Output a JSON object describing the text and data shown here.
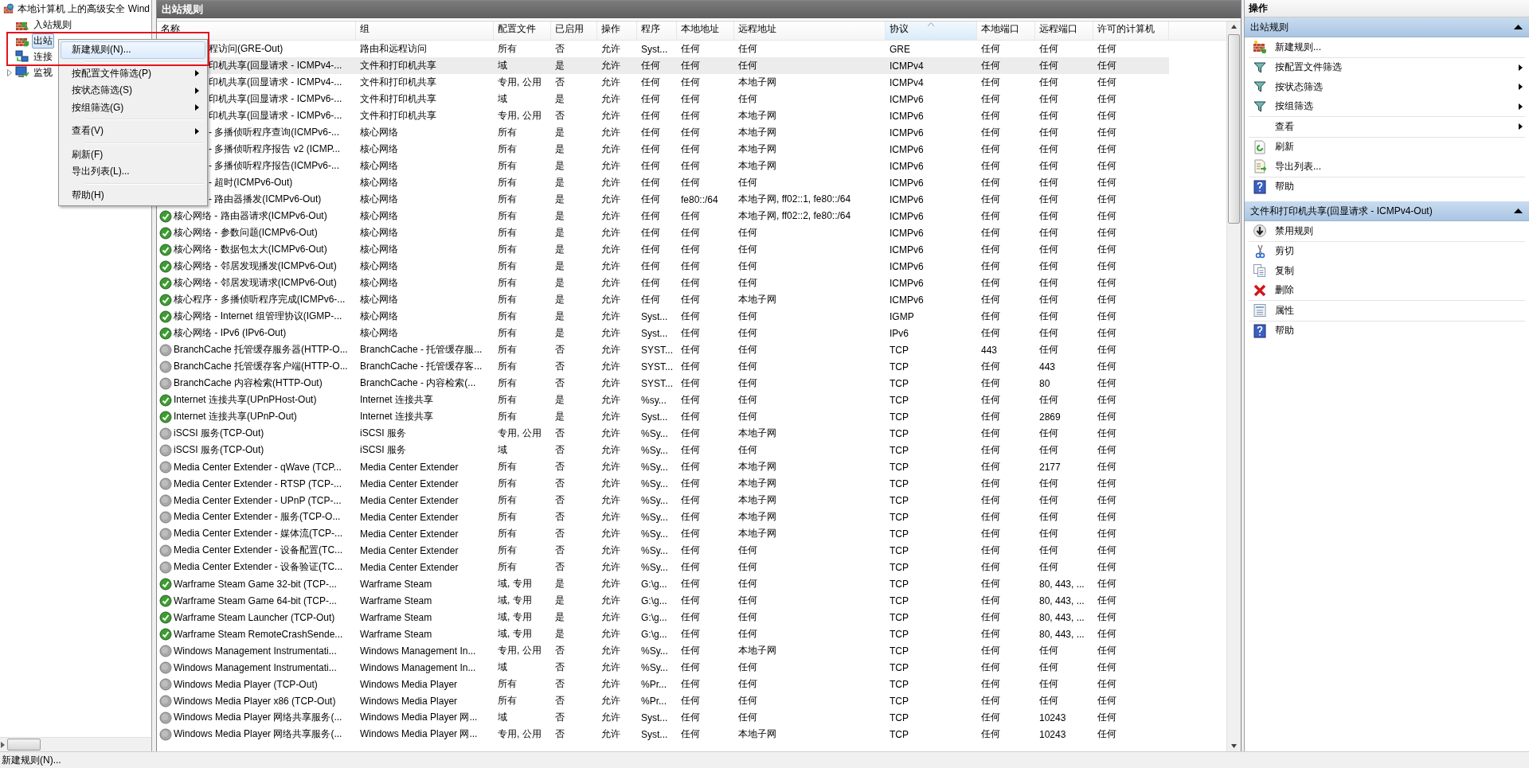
{
  "tree": {
    "label": "本地计算机 上的高级安全 Wind",
    "kind": "root",
    "children": [
      {
        "label": "入站规则",
        "kind": "inbound",
        "selected": false
      },
      {
        "label": "出站",
        "kind": "outbound",
        "selected": true
      },
      {
        "label": "连接",
        "kind": "connection",
        "selected": false
      },
      {
        "label": "监视",
        "kind": "monitor",
        "selected": false,
        "expanded": false
      }
    ]
  },
  "context_menu": {
    "groups": [
      {
        "items": [
          {
            "label": "新建规则(N)...",
            "selected": true,
            "submenu": false
          }
        ]
      },
      {
        "items": [
          {
            "label": "按配置文件筛选(P)",
            "selected": false,
            "submenu": true
          },
          {
            "label": "按状态筛选(S)",
            "selected": false,
            "submenu": true
          },
          {
            "label": "按组筛选(G)",
            "selected": false,
            "submenu": true
          }
        ]
      },
      {
        "items": [
          {
            "label": "查看(V)",
            "selected": false,
            "submenu": true
          }
        ]
      },
      {
        "items": [
          {
            "label": "刷新(F)",
            "selected": false,
            "submenu": false
          },
          {
            "label": "导出列表(L)...",
            "selected": false,
            "submenu": false
          }
        ]
      },
      {
        "items": [
          {
            "label": "帮助(H)",
            "selected": false,
            "submenu": false
          }
        ]
      }
    ]
  },
  "center": {
    "title": "出站规则",
    "columns": [
      {
        "label": "名称",
        "sorted": false
      },
      {
        "label": "组",
        "sorted": false
      },
      {
        "label": "配置文件",
        "sorted": false
      },
      {
        "label": "已启用",
        "sorted": false
      },
      {
        "label": "操作",
        "sorted": false
      },
      {
        "label": "程序",
        "sorted": false
      },
      {
        "label": "本地地址",
        "sorted": false
      },
      {
        "label": "远程地址",
        "sorted": false
      },
      {
        "label": "协议",
        "sorted": true
      },
      {
        "label": "本地端口",
        "sorted": false
      },
      {
        "label": "远程端口",
        "sorted": false
      },
      {
        "label": "许可的计算机",
        "sorted": false
      }
    ],
    "rows": [
      {
        "covered": true,
        "selected": false,
        "cells": [
          "程访问(GRE-Out)",
          "路由和远程访问",
          "所有",
          "否",
          "允许",
          "Syst...",
          "任何",
          "任何",
          "GRE",
          "任何",
          "任何",
          "任何"
        ]
      },
      {
        "covered": true,
        "selected": true,
        "cells": [
          "印机共享(回显请求 - ICMPv4-...",
          "文件和打印机共享",
          "域",
          "是",
          "允许",
          "任何",
          "任何",
          "任何",
          "ICMPv4",
          "任何",
          "任何",
          "任何"
        ]
      },
      {
        "covered": true,
        "selected": false,
        "cells": [
          "印机共享(回显请求 - ICMPv4-...",
          "文件和打印机共享",
          "专用, 公用",
          "否",
          "允许",
          "任何",
          "任何",
          "本地子网",
          "ICMPv4",
          "任何",
          "任何",
          "任何"
        ]
      },
      {
        "covered": true,
        "selected": false,
        "cells": [
          "印机共享(回显请求 - ICMPv6-...",
          "文件和打印机共享",
          "域",
          "是",
          "允许",
          "任何",
          "任何",
          "任何",
          "ICMPv6",
          "任何",
          "任何",
          "任何"
        ]
      },
      {
        "covered": true,
        "selected": false,
        "cells": [
          "印机共享(回显请求 - ICMPv6-...",
          "文件和打印机共享",
          "专用, 公用",
          "否",
          "允许",
          "任何",
          "任何",
          "本地子网",
          "ICMPv6",
          "任何",
          "任何",
          "任何"
        ]
      },
      {
        "covered": true,
        "selected": false,
        "cells": [
          "- 多播侦听程序查询(ICMPv6-...",
          "核心网络",
          "所有",
          "是",
          "允许",
          "任何",
          "任何",
          "本地子网",
          "ICMPv6",
          "任何",
          "任何",
          "任何"
        ]
      },
      {
        "covered": true,
        "selected": false,
        "cells": [
          "- 多播侦听程序报告 v2 (ICMP...",
          "核心网络",
          "所有",
          "是",
          "允许",
          "任何",
          "任何",
          "本地子网",
          "ICMPv6",
          "任何",
          "任何",
          "任何"
        ]
      },
      {
        "covered": true,
        "selected": false,
        "cells": [
          "- 多播侦听程序报告(ICMPv6-...",
          "核心网络",
          "所有",
          "是",
          "允许",
          "任何",
          "任何",
          "本地子网",
          "ICMPv6",
          "任何",
          "任何",
          "任何"
        ]
      },
      {
        "covered": true,
        "selected": false,
        "cells": [
          "- 超时(ICMPv6-Out)",
          "核心网络",
          "所有",
          "是",
          "允许",
          "任何",
          "任何",
          "任何",
          "ICMPv6",
          "任何",
          "任何",
          "任何"
        ]
      },
      {
        "covered": true,
        "selected": false,
        "cells": [
          "- 路由器播发(ICMPv6-Out)",
          "核心网络",
          "所有",
          "是",
          "允许",
          "任何",
          "fe80::/64",
          "本地子网, ff02::1, fe80::/64",
          "ICMPv6",
          "任何",
          "任何",
          "任何"
        ]
      },
      {
        "covered": false,
        "enabled": true,
        "selected": false,
        "cells": [
          "核心网络 - 路由器请求(ICMPv6-Out)",
          "核心网络",
          "所有",
          "是",
          "允许",
          "任何",
          "任何",
          "本地子网, ff02::2, fe80::/64",
          "ICMPv6",
          "任何",
          "任何",
          "任何"
        ]
      },
      {
        "covered": false,
        "enabled": true,
        "selected": false,
        "cells": [
          "核心网络 - 参数问题(ICMPv6-Out)",
          "核心网络",
          "所有",
          "是",
          "允许",
          "任何",
          "任何",
          "任何",
          "ICMPv6",
          "任何",
          "任何",
          "任何"
        ]
      },
      {
        "covered": false,
        "enabled": true,
        "selected": false,
        "cells": [
          "核心网络 - 数据包太大(ICMPv6-Out)",
          "核心网络",
          "所有",
          "是",
          "允许",
          "任何",
          "任何",
          "任何",
          "ICMPv6",
          "任何",
          "任何",
          "任何"
        ]
      },
      {
        "covered": false,
        "enabled": true,
        "selected": false,
        "cells": [
          "核心网络 - 邻居发现播发(ICMPv6-Out)",
          "核心网络",
          "所有",
          "是",
          "允许",
          "任何",
          "任何",
          "任何",
          "ICMPv6",
          "任何",
          "任何",
          "任何"
        ]
      },
      {
        "covered": false,
        "enabled": true,
        "selected": false,
        "cells": [
          "核心网络 - 邻居发现请求(ICMPv6-Out)",
          "核心网络",
          "所有",
          "是",
          "允许",
          "任何",
          "任何",
          "任何",
          "ICMPv6",
          "任何",
          "任何",
          "任何"
        ]
      },
      {
        "covered": false,
        "enabled": true,
        "selected": false,
        "cells": [
          "核心程序 - 多播侦听程序完成(ICMPv6-...",
          "核心网络",
          "所有",
          "是",
          "允许",
          "任何",
          "任何",
          "本地子网",
          "ICMPv6",
          "任何",
          "任何",
          "任何"
        ]
      },
      {
        "covered": false,
        "enabled": true,
        "selected": false,
        "cells": [
          "核心网络 - Internet 组管理协议(IGMP-...",
          "核心网络",
          "所有",
          "是",
          "允许",
          "Syst...",
          "任何",
          "任何",
          "IGMP",
          "任何",
          "任何",
          "任何"
        ]
      },
      {
        "covered": false,
        "enabled": true,
        "selected": false,
        "cells": [
          "核心网络 - IPv6 (IPv6-Out)",
          "核心网络",
          "所有",
          "是",
          "允许",
          "Syst...",
          "任何",
          "任何",
          "IPv6",
          "任何",
          "任何",
          "任何"
        ]
      },
      {
        "covered": false,
        "enabled": false,
        "selected": false,
        "cells": [
          "BranchCache 托管缓存服务器(HTTP-O...",
          "BranchCache - 托管缓存服...",
          "所有",
          "否",
          "允许",
          "SYST...",
          "任何",
          "任何",
          "TCP",
          "443",
          "任何",
          "任何"
        ]
      },
      {
        "covered": false,
        "enabled": false,
        "selected": false,
        "cells": [
          "BranchCache 托管缓存客户端(HTTP-O...",
          "BranchCache - 托管缓存客...",
          "所有",
          "否",
          "允许",
          "SYST...",
          "任何",
          "任何",
          "TCP",
          "任何",
          "443",
          "任何"
        ]
      },
      {
        "covered": false,
        "enabled": false,
        "selected": false,
        "cells": [
          "BranchCache 内容检索(HTTP-Out)",
          "BranchCache - 内容检索(...",
          "所有",
          "否",
          "允许",
          "SYST...",
          "任何",
          "任何",
          "TCP",
          "任何",
          "80",
          "任何"
        ]
      },
      {
        "covered": false,
        "enabled": true,
        "selected": false,
        "cells": [
          "Internet 连接共享(UPnPHost-Out)",
          "Internet 连接共享",
          "所有",
          "是",
          "允许",
          "%sy...",
          "任何",
          "任何",
          "TCP",
          "任何",
          "任何",
          "任何"
        ]
      },
      {
        "covered": false,
        "enabled": true,
        "selected": false,
        "cells": [
          "Internet 连接共享(UPnP-Out)",
          "Internet 连接共享",
          "所有",
          "是",
          "允许",
          "Syst...",
          "任何",
          "任何",
          "TCP",
          "任何",
          "2869",
          "任何"
        ]
      },
      {
        "covered": false,
        "enabled": false,
        "selected": false,
        "cells": [
          "iSCSI 服务(TCP-Out)",
          "iSCSI 服务",
          "专用, 公用",
          "否",
          "允许",
          "%Sy...",
          "任何",
          "本地子网",
          "TCP",
          "任何",
          "任何",
          "任何"
        ]
      },
      {
        "covered": false,
        "enabled": false,
        "selected": false,
        "cells": [
          "iSCSI 服务(TCP-Out)",
          "iSCSI 服务",
          "域",
          "否",
          "允许",
          "%Sy...",
          "任何",
          "任何",
          "TCP",
          "任何",
          "任何",
          "任何"
        ]
      },
      {
        "covered": false,
        "enabled": false,
        "selected": false,
        "cells": [
          "Media Center Extender - qWave (TCP...",
          "Media Center Extender",
          "所有",
          "否",
          "允许",
          "%Sy...",
          "任何",
          "本地子网",
          "TCP",
          "任何",
          "2177",
          "任何"
        ]
      },
      {
        "covered": false,
        "enabled": false,
        "selected": false,
        "cells": [
          "Media Center Extender - RTSP (TCP-...",
          "Media Center Extender",
          "所有",
          "否",
          "允许",
          "%Sy...",
          "任何",
          "本地子网",
          "TCP",
          "任何",
          "任何",
          "任何"
        ]
      },
      {
        "covered": false,
        "enabled": false,
        "selected": false,
        "cells": [
          "Media Center Extender - UPnP (TCP-...",
          "Media Center Extender",
          "所有",
          "否",
          "允许",
          "%Sy...",
          "任何",
          "本地子网",
          "TCP",
          "任何",
          "任何",
          "任何"
        ]
      },
      {
        "covered": false,
        "enabled": false,
        "selected": false,
        "cells": [
          "Media Center Extender - 服务(TCP-O...",
          "Media Center Extender",
          "所有",
          "否",
          "允许",
          "%Sy...",
          "任何",
          "本地子网",
          "TCP",
          "任何",
          "任何",
          "任何"
        ]
      },
      {
        "covered": false,
        "enabled": false,
        "selected": false,
        "cells": [
          "Media Center Extender - 媒体流(TCP-...",
          "Media Center Extender",
          "所有",
          "否",
          "允许",
          "%Sy...",
          "任何",
          "本地子网",
          "TCP",
          "任何",
          "任何",
          "任何"
        ]
      },
      {
        "covered": false,
        "enabled": false,
        "selected": false,
        "cells": [
          "Media Center Extender - 设备配置(TC...",
          "Media Center Extender",
          "所有",
          "否",
          "允许",
          "%Sy...",
          "任何",
          "任何",
          "TCP",
          "任何",
          "任何",
          "任何"
        ]
      },
      {
        "covered": false,
        "enabled": false,
        "selected": false,
        "cells": [
          "Media Center Extender - 设备验证(TC...",
          "Media Center Extender",
          "所有",
          "否",
          "允许",
          "%Sy...",
          "任何",
          "任何",
          "TCP",
          "任何",
          "任何",
          "任何"
        ]
      },
      {
        "covered": false,
        "enabled": true,
        "selected": false,
        "cells": [
          "Warframe Steam Game 32-bit (TCP-...",
          "Warframe Steam",
          "域, 专用",
          "是",
          "允许",
          "G:\\g...",
          "任何",
          "任何",
          "TCP",
          "任何",
          "80, 443, ...",
          "任何"
        ]
      },
      {
        "covered": false,
        "enabled": true,
        "selected": false,
        "cells": [
          "Warframe Steam Game 64-bit (TCP-...",
          "Warframe Steam",
          "域, 专用",
          "是",
          "允许",
          "G:\\g...",
          "任何",
          "任何",
          "TCP",
          "任何",
          "80, 443, ...",
          "任何"
        ]
      },
      {
        "covered": false,
        "enabled": true,
        "selected": false,
        "cells": [
          "Warframe Steam Launcher (TCP-Out)",
          "Warframe Steam",
          "域, 专用",
          "是",
          "允许",
          "G:\\g...",
          "任何",
          "任何",
          "TCP",
          "任何",
          "80, 443, ...",
          "任何"
        ]
      },
      {
        "covered": false,
        "enabled": true,
        "selected": false,
        "cells": [
          "Warframe Steam RemoteCrashSende...",
          "Warframe Steam",
          "域, 专用",
          "是",
          "允许",
          "G:\\g...",
          "任何",
          "任何",
          "TCP",
          "任何",
          "80, 443, ...",
          "任何"
        ]
      },
      {
        "covered": false,
        "enabled": false,
        "selected": false,
        "cells": [
          "Windows Management Instrumentati...",
          "Windows Management In...",
          "专用, 公用",
          "否",
          "允许",
          "%Sy...",
          "任何",
          "本地子网",
          "TCP",
          "任何",
          "任何",
          "任何"
        ]
      },
      {
        "covered": false,
        "enabled": false,
        "selected": false,
        "cells": [
          "Windows Management Instrumentati...",
          "Windows Management In...",
          "域",
          "否",
          "允许",
          "%Sy...",
          "任何",
          "任何",
          "TCP",
          "任何",
          "任何",
          "任何"
        ]
      },
      {
        "covered": false,
        "enabled": false,
        "selected": false,
        "cells": [
          "Windows Media Player (TCP-Out)",
          "Windows Media Player",
          "所有",
          "否",
          "允许",
          "%Pr...",
          "任何",
          "任何",
          "TCP",
          "任何",
          "任何",
          "任何"
        ]
      },
      {
        "covered": false,
        "enabled": false,
        "selected": false,
        "cells": [
          "Windows Media Player x86 (TCP-Out)",
          "Windows Media Player",
          "所有",
          "否",
          "允许",
          "%Pr...",
          "任何",
          "任何",
          "TCP",
          "任何",
          "任何",
          "任何"
        ]
      },
      {
        "covered": false,
        "enabled": false,
        "selected": false,
        "cells": [
          "Windows Media Player 网络共享服务(...",
          "Windows Media Player 网...",
          "域",
          "否",
          "允许",
          "Syst...",
          "任何",
          "任何",
          "TCP",
          "任何",
          "10243",
          "任何"
        ]
      },
      {
        "covered": false,
        "enabled": false,
        "selected": false,
        "cells": [
          "Windows Media Player 网络共享服务(...",
          "Windows Media Player 网...",
          "专用, 公用",
          "否",
          "允许",
          "Syst...",
          "任何",
          "本地子网",
          "TCP",
          "任何",
          "10243",
          "任何"
        ]
      }
    ]
  },
  "actions": {
    "title": "操作",
    "sections": [
      {
        "title": "出站规则",
        "expanded": true,
        "groups": [
          {
            "items": [
              {
                "label": "新建规则...",
                "kind": "new-rule",
                "submenu": false
              }
            ]
          },
          {
            "items": [
              {
                "label": "按配置文件筛选",
                "kind": "filter",
                "submenu": true
              },
              {
                "label": "按状态筛选",
                "kind": "filter",
                "submenu": true
              },
              {
                "label": "按组筛选",
                "kind": "filter",
                "submenu": true
              }
            ]
          },
          {
            "items": [
              {
                "label": "查看",
                "kind": "plain",
                "submenu": true
              }
            ]
          },
          {
            "items": [
              {
                "label": "刷新",
                "kind": "refresh",
                "submenu": false
              },
              {
                "label": "导出列表...",
                "kind": "export",
                "submenu": false
              }
            ]
          },
          {
            "items": [
              {
                "label": "帮助",
                "kind": "help",
                "submenu": false
              }
            ]
          }
        ]
      },
      {
        "title": "文件和打印机共享(回显请求 - ICMPv4-Out)",
        "expanded": true,
        "groups": [
          {
            "items": [
              {
                "label": "禁用规则",
                "kind": "disable",
                "submenu": false
              }
            ]
          },
          {
            "items": [
              {
                "label": "剪切",
                "kind": "cut",
                "submenu": false
              },
              {
                "label": "复制",
                "kind": "copy",
                "submenu": false
              },
              {
                "label": "删除",
                "kind": "delete",
                "submenu": false
              }
            ]
          },
          {
            "items": [
              {
                "label": "属性",
                "kind": "properties",
                "submenu": false
              }
            ]
          },
          {
            "items": [
              {
                "label": "帮助",
                "kind": "help",
                "submenu": false
              }
            ]
          }
        ]
      }
    ]
  },
  "status_bar": "新建规则(N)..."
}
